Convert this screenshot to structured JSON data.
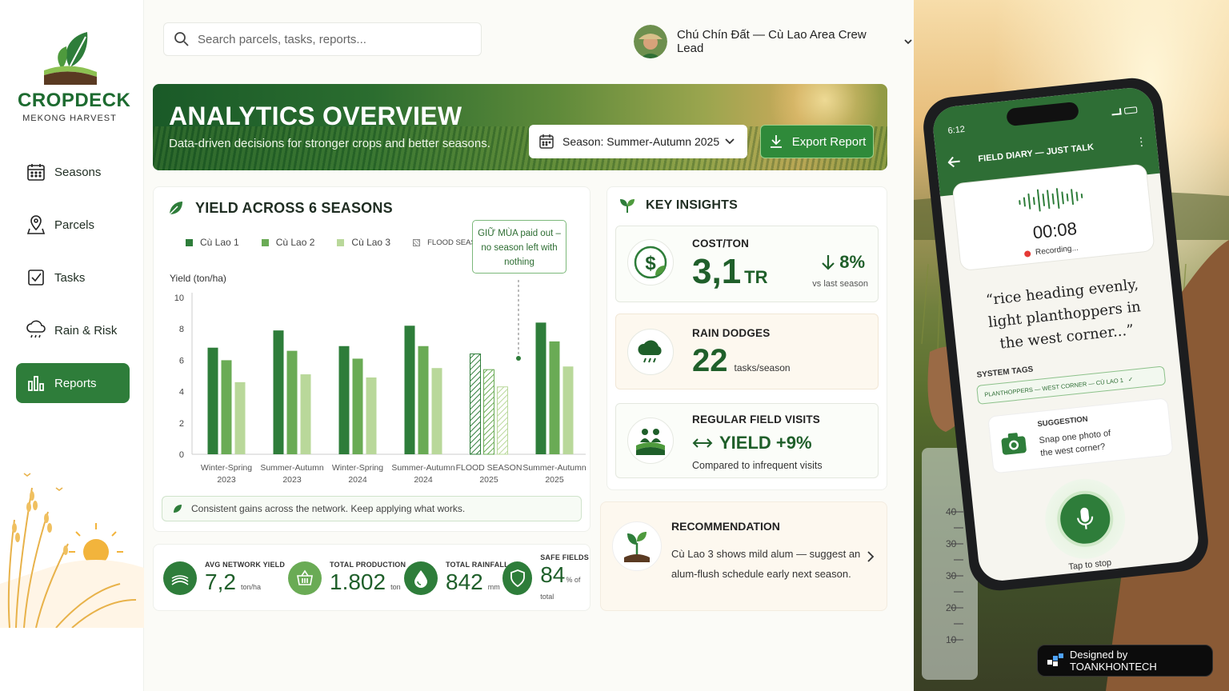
{
  "brand": {
    "name": "CROPDECK",
    "tagline": "MEKONG HARVEST"
  },
  "nav": [
    {
      "label": "Seasons",
      "icon": "calendar-icon"
    },
    {
      "label": "Parcels",
      "icon": "map-pin-icon"
    },
    {
      "label": "Tasks",
      "icon": "checkbox-icon"
    },
    {
      "label": "Rain & Risk",
      "icon": "cloud-rain-icon"
    },
    {
      "label": "Reports",
      "icon": "bar-chart-icon",
      "active": true
    }
  ],
  "search": {
    "placeholder": "Search parcels, tasks, reports..."
  },
  "user": {
    "name": "Chú Chín Đất — Cù Lao Area Crew Lead"
  },
  "hero": {
    "title": "ANALYTICS OVERVIEW",
    "subtitle": "Data-driven decisions for stronger crops and better seasons.",
    "season_select": "Season: Summer-Autumn 2025",
    "export_label": "Export Report"
  },
  "yield": {
    "title": "YIELD ACROSS 6 SEASONS",
    "callout_lines": [
      "GIỮ MÙA paid out –",
      "no season left with",
      "nothing"
    ],
    "note": "Consistent gains across the network. Keep applying what works."
  },
  "chart_data": {
    "type": "bar",
    "ylabel": "Yield (ton/ha)",
    "ylim": [
      0,
      10
    ],
    "yticks": [
      0,
      2,
      4,
      6,
      8,
      10
    ],
    "categories": [
      [
        "Winter-Spring",
        "2023"
      ],
      [
        "Summer-Autumn",
        "2023"
      ],
      [
        "Winter-Spring",
        "2024"
      ],
      [
        "Summer-Autumn",
        "2024"
      ],
      [
        "FLOOD SEASON",
        "2025"
      ],
      [
        "Summer-Autumn",
        "2025"
      ]
    ],
    "series": [
      {
        "name": "Cù Lao 1",
        "color": "#2e7d3a",
        "values": [
          6.8,
          7.9,
          6.9,
          8.2,
          6.4,
          8.4
        ]
      },
      {
        "name": "Cù Lao 2",
        "color": "#6aab55",
        "values": [
          6.0,
          6.6,
          6.1,
          6.9,
          5.4,
          7.2
        ]
      },
      {
        "name": "Cù Lao 3",
        "color": "#b9d89a",
        "values": [
          4.6,
          5.1,
          4.9,
          5.5,
          4.3,
          5.6
        ]
      }
    ],
    "extra_legend": "FLOOD SEASON 2025",
    "hatched_category": 4
  },
  "stats": [
    {
      "label": "AVG NETWORK YIELD",
      "value": "7,2",
      "unit": "ton/ha",
      "icon": "field-icon"
    },
    {
      "label": "TOTAL PRODUCTION",
      "value": "1.802",
      "unit": "ton",
      "icon": "basket-icon"
    },
    {
      "label": "TOTAL RAINFALL",
      "value": "842",
      "unit": "mm",
      "icon": "water-drop-icon"
    },
    {
      "label": "SAFE FIELDS",
      "value": "84",
      "unit": "% of total",
      "icon": "shield-icon"
    }
  ],
  "insights": {
    "title": "KEY INSIGHTS",
    "cost": {
      "label": "COST/TON",
      "value": "3,1",
      "unit": "TR",
      "delta": "8%",
      "delta_note": "vs last season",
      "icon": "dollar-leaf-icon"
    },
    "rain": {
      "label": "RAIN DODGES",
      "value": "22",
      "unit": "tasks/season",
      "icon": "cloud-rain-icon"
    },
    "visits": {
      "label": "REGULAR FIELD VISITS",
      "value": "YIELD +9%",
      "note": "Compared to infrequent visits",
      "icon": "farmers-icon"
    }
  },
  "recommendation": {
    "label": "RECOMMENDATION",
    "text_lines": [
      "Cù Lao 3 shows mild alum — suggest an",
      "alum-flush schedule early next season."
    ],
    "icon": "seedling-icon"
  },
  "phone": {
    "time": "6:12",
    "header": "FIELD DIARY — JUST TALK",
    "timer": "00:08",
    "status": "Recording...",
    "quote_lines": [
      "“rice heading evenly,",
      "light planthoppers in",
      "the west corner...”"
    ],
    "tags_label": "SYSTEM TAGS",
    "tag": "PLANTHOPPERS — WEST CORNER — CÙ LAO 1",
    "suggestion_label": "SUGGESTION",
    "suggestion_lines": [
      "Snap one photo of",
      "the west corner?"
    ],
    "mic_label": "Tap to stop"
  },
  "gauge_ticks": [
    "40",
    "30",
    "30",
    "20",
    "10"
  ],
  "credit": "Designed by TOANKHONTECH"
}
